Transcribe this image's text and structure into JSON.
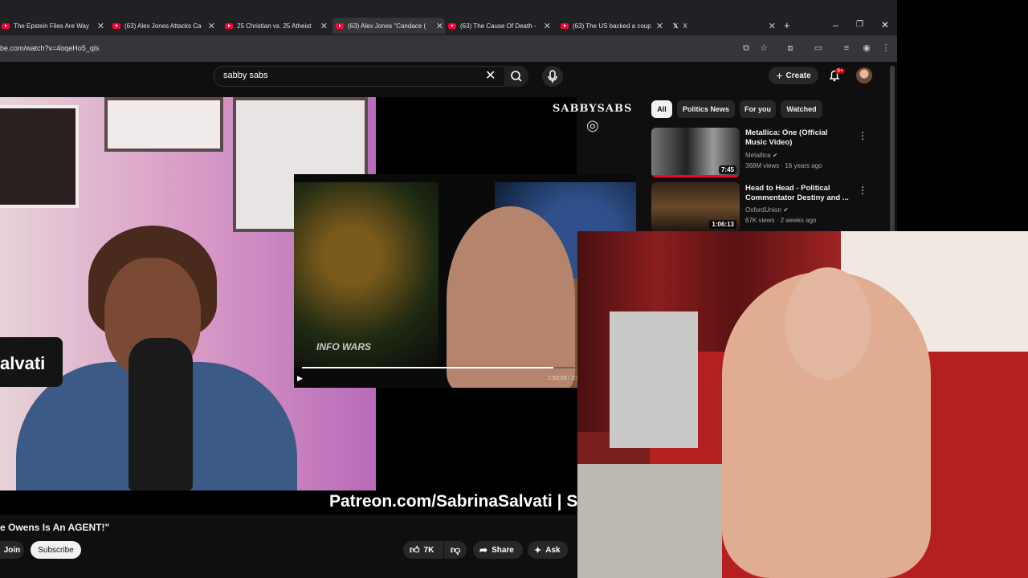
{
  "browser": {
    "tabs": [
      {
        "title": "The Epstein Files Are Way",
        "active": false
      },
      {
        "title": "(63) Alex Jones Attacks Ca",
        "active": false
      },
      {
        "title": "25 Christian vs. 25 Atheist",
        "active": false
      },
      {
        "title": "(63) Alex Jones \"Candace (",
        "active": true
      },
      {
        "title": "(63) The Cause Of Death -",
        "active": false
      },
      {
        "title": "(63) The US backed a coup",
        "active": false
      },
      {
        "title": "X",
        "active": false
      }
    ],
    "new_tab": "+",
    "url": "be.com/watch?v=4oqeHo5_qls"
  },
  "youtube": {
    "search_value": "sabby sabs",
    "create_label": "Create",
    "notification_badge": "9+",
    "video_title": "e Owens Is An AGENT!\"",
    "join_label": "Join",
    "subscribe_label": "Subscribe",
    "like_count": "7K",
    "share_label": "Share",
    "ask_label": "Ask",
    "chips": [
      "All",
      "Politics News",
      "For you",
      "Watched"
    ],
    "recommended": [
      {
        "title": "Metallica: One (Official Music Video)",
        "channel": "Metallica",
        "meta": "368M views · 16 years ago",
        "duration": "7:45"
      },
      {
        "title": "Head to Head - Political Commentator Destiny and ...",
        "channel": "OxfordUnion",
        "meta": "67K views · 2 weeks ago",
        "duration": "1:06:13"
      }
    ]
  },
  "video_overlay": {
    "logo_text": "SABBYSABS",
    "name_fragment": "alvati",
    "pip_time": "1:53:09 / 2:1",
    "pip_progress": 0.92,
    "pip_logo": "INFO WARS",
    "patreon_banner": "Patreon.com/SabrinaSalvati | Sa"
  }
}
